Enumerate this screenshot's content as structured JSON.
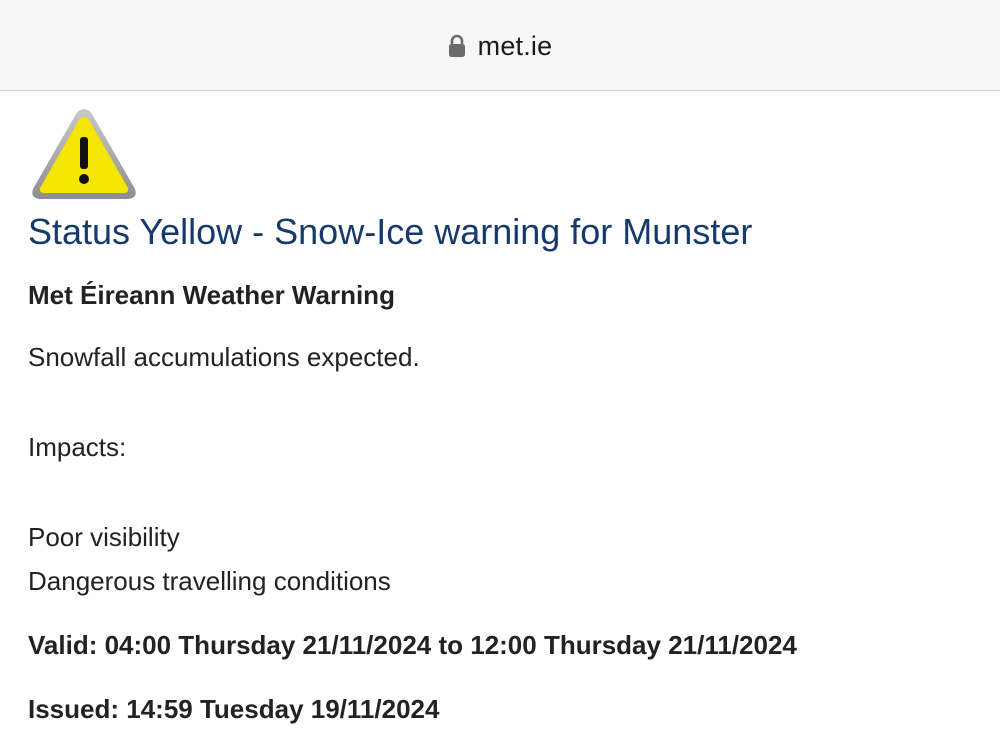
{
  "browser": {
    "url": "met.ie",
    "lock_icon": "lock-icon"
  },
  "warning": {
    "icon": "warning-triangle-icon",
    "icon_color": "#f5e600",
    "title": "Status Yellow - Snow-Ice warning for Munster",
    "title_color": "#163a6b",
    "subtitle": "Met Éireann Weather Warning",
    "summary": "Snowfall accumulations expected.",
    "impacts_label": "Impacts:",
    "impacts": [
      "Poor visibility",
      "Dangerous travelling conditions"
    ],
    "valid": "Valid: 04:00 Thursday 21/11/2024 to 12:00 Thursday 21/11/2024",
    "issued": "Issued: 14:59 Tuesday 19/11/2024"
  }
}
